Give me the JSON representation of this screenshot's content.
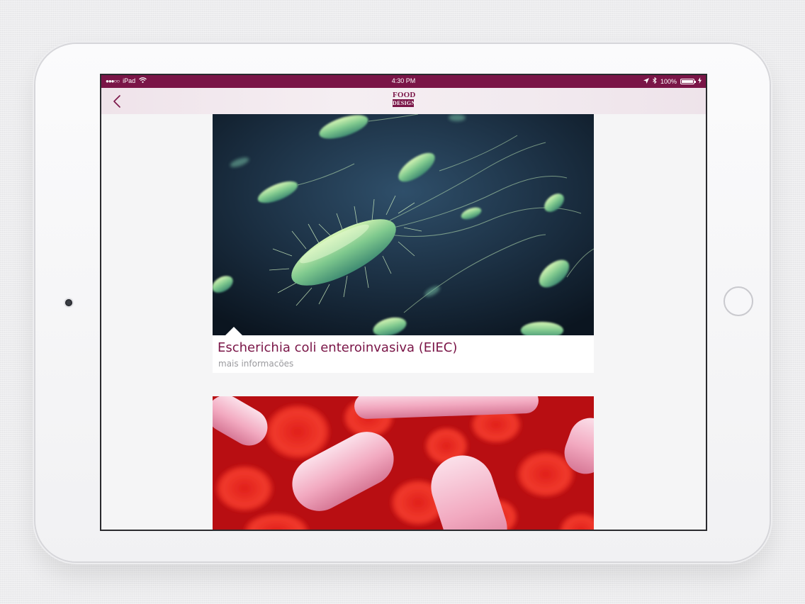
{
  "status_bar": {
    "carrier": "iPad",
    "time": "4:30 PM",
    "battery_percent": "100%",
    "battery_level": 1.0
  },
  "nav": {
    "logo_top": "FOOD",
    "logo_bottom": "DESIGN"
  },
  "cards": [
    {
      "title": "Escherichia coli enteroinvasiva (EIEC)",
      "subtitle": "mais informacões"
    }
  ],
  "colors": {
    "brand": "#7a1547",
    "subtitle": "#9a9a9e"
  }
}
